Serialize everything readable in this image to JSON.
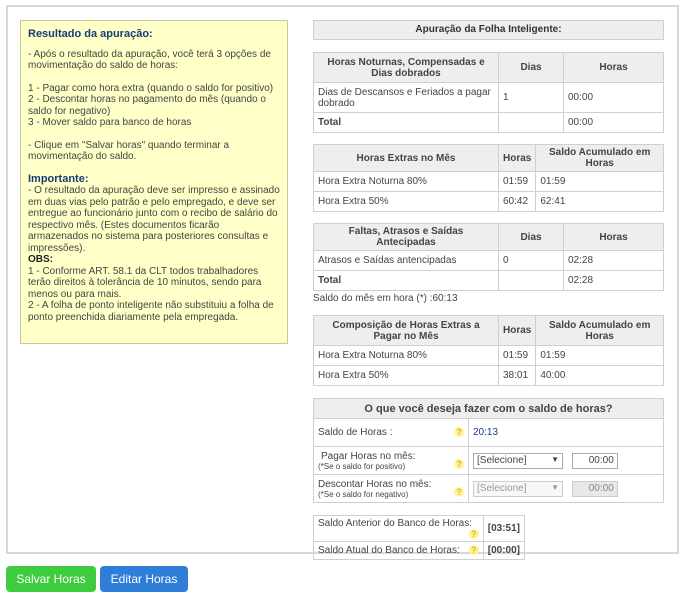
{
  "info": {
    "heading": "Resultado da apuração:",
    "line1": "- Após o resultado da apuração, você terá 3 opções de movimentação do saldo de horas:",
    "opt1": "1 - Pagar como hora extra (quando o saldo for positivo)",
    "opt2": "2 - Descontar horas no pagamento do mês (quando o saldo for negativo)",
    "opt3": "3 - Mover saldo para banco de horas",
    "click": "- Clique em \"Salvar horas\" quando terminar a movimentação do saldo.",
    "important": "Importante:",
    "imp1": "- O resultado da apuração deve ser impresso e assinado em duas vias pelo patrão e pelo empregado, e deve ser entregue ao funcionário junto com o recibo de salário do respectivo mês. (Estes documentos ficarão armazenados no sistema para posteriores consultas e impressões).",
    "obs": "OBS:",
    "obs1": "1 - Conforme ART. 58.1 da CLT todos trabalhadores terão direitos à tolerância de 10 minutos, sendo para menos ou para mais.",
    "obs2": "2 - A folha de ponto inteligente não substituiu a folha de ponto preenchida diariamente pela empregada."
  },
  "panel_title": "Apuração da Folha Inteligente:",
  "noturnas": {
    "h1": "Horas Noturnas, Compensadas e Dias dobrados",
    "h2": "Dias",
    "h3": "Horas",
    "r1c1": "Dias de Descansos e Feriados a pagar dobrado",
    "r1c2": "1",
    "r1c3": "00:00",
    "tot": "Total",
    "totc3": "00:00"
  },
  "extras": {
    "h1": "Horas Extras no Mês",
    "h2": "Horas",
    "h3": "Saldo Acumulado em Horas",
    "r1c1": "Hora Extra Noturna 80%",
    "r1c2": "01:59",
    "r1c3": "01:59",
    "r2c1": "Hora Extra 50%",
    "r2c2": "60:42",
    "r2c3": "62:41"
  },
  "faltas": {
    "h1": "Faltas, Atrasos e Saídas Antecipadas",
    "h2": "Dias",
    "h3": "Horas",
    "r1c1": "Atrasos e Saídas antencipadas",
    "r1c2": "0",
    "r1c3": "02:28",
    "tot": "Total",
    "totc3": "02:28"
  },
  "saldo_note": "Saldo do mês em hora (*) :60:13",
  "composicao": {
    "h1": "Composição de Horas Extras a Pagar no Mês",
    "h2": "Horas",
    "h3": "Saldo Acumulado em Horas",
    "r1c1": "Hora Extra Noturna 80%",
    "r1c2": "01:59",
    "r1c3": "01:59",
    "r2c1": "Hora Extra 50%",
    "r2c2": "38:01",
    "r2c3": "40:00"
  },
  "question": {
    "title": "O que você deseja fazer com o saldo de horas?",
    "saldo_label": "Saldo de Horas :",
    "saldo_value": "20:13",
    "pagar_label": "Pagar Horas no mês:",
    "pagar_hint": "(*Se o saldo for positivo)",
    "pagar_select": "[Selecione]",
    "pagar_time": "00:00",
    "desc_label": "Descontar Horas no mês:",
    "desc_hint": "(*Se o saldo for negativo)",
    "desc_select": "[Selecione]",
    "desc_time": "00:00",
    "help": "?"
  },
  "bank": {
    "anterior_label": "Saldo Anterior do Banco de Horas:",
    "anterior_value": "[03:51]",
    "atual_label": "Saldo Atual do Banco de Horas:",
    "atual_value": "[00:00]"
  },
  "buttons": {
    "save": "Salvar Horas",
    "edit": "Editar Horas"
  }
}
